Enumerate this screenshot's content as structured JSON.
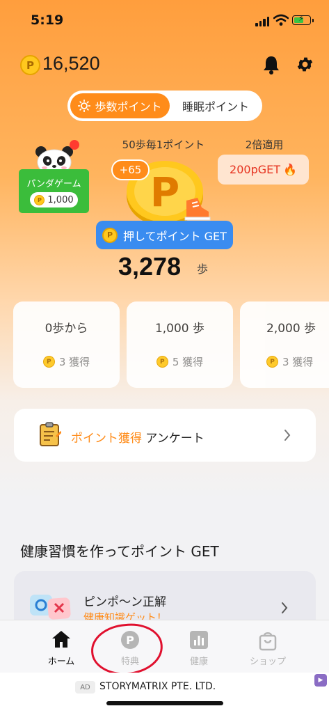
{
  "status_bar": {
    "time": "5:19"
  },
  "header": {
    "coin_symbol": "P",
    "points": "16,520"
  },
  "mode_tabs": {
    "active": "歩数ポイント",
    "inactive": "睡眠ポイント"
  },
  "panda_game": {
    "title": "パンダゲーム",
    "reward": "1,000"
  },
  "steps_panel": {
    "rate_label": "50歩毎1ポイント",
    "double_label": "2倍適用",
    "bonus_label": "200pGET",
    "plus_badge": "+65",
    "coin_letter": "P",
    "press_button": "押してポイント GET",
    "step_count": "3,278",
    "step_unit": "歩"
  },
  "milestones": [
    {
      "label": "0歩から",
      "reward": "3 獲得"
    },
    {
      "label": "1,000 歩",
      "reward": "5 獲得"
    },
    {
      "label": "2,000 歩",
      "reward": "3 獲得"
    }
  ],
  "survey": {
    "highlight": "ポイント獲得",
    "label": "アンケート"
  },
  "habits": {
    "title": "健康習慣を作ってポイント GET",
    "quiz_title": "ピンポ〜ン正解",
    "quiz_subtitle": "健康知識ゲット！"
  },
  "tabbar": {
    "items": [
      {
        "label": "ホーム",
        "icon": "home-icon"
      },
      {
        "label": "特典",
        "icon": "point-icon"
      },
      {
        "label": "健康",
        "icon": "chart-icon"
      },
      {
        "label": "ショップ",
        "icon": "shopping-bag-icon"
      }
    ]
  },
  "ad": {
    "tag": "AD",
    "text": "STORYMATRIX PTE. LTD."
  },
  "colors": {
    "accent": "#ff8c1a",
    "button_blue": "#3a8cf0",
    "panda_green": "#3bbd3b",
    "annotation_red": "#e0102e"
  }
}
